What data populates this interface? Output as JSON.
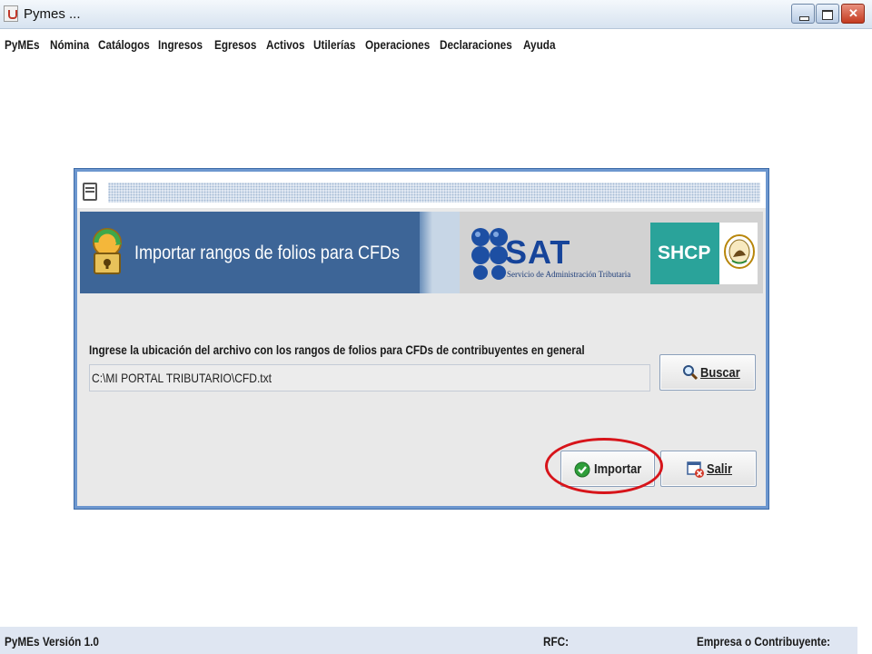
{
  "window": {
    "title": "Pymes ..."
  },
  "menubar": {
    "items": [
      "PyMEs",
      "Nómina",
      "Catálogos",
      "Ingresos",
      "Egresos",
      "Activos",
      "Utilerías",
      "Operaciones",
      "Declaraciones",
      "Ayuda"
    ]
  },
  "dialog": {
    "header_title": "Importar rangos de folios para CFDs",
    "logos": {
      "sat_text": "SAT",
      "sat_subtitle": "Servicio de Administración Tributaria",
      "shcp_text": "SHCP"
    },
    "prompt_label": "Ingrese la ubicación del archivo con los rangos de folios para CFDs de contribuyentes en general",
    "file_path_value": "C:\\MI PORTAL TRIBUTARIO\\CFD.txt",
    "buttons": {
      "buscar": "Buscar",
      "importar": "Importar",
      "salir": "Salir"
    },
    "icons": {
      "buscar": "magnifier-icon",
      "importar": "green-check-icon",
      "salir": "exit-window-icon",
      "header": "key-folder-icon"
    }
  },
  "statusbar": {
    "version": "PyMEs Versión 1.0",
    "rfc_label": "RFC:",
    "company_label": "Empresa o Contribuyente:"
  },
  "colors": {
    "header_blue": "#3d6597",
    "sat_blue": "#16449a",
    "shcp_teal": "#2aa39a",
    "highlight_red": "#d7141a"
  }
}
